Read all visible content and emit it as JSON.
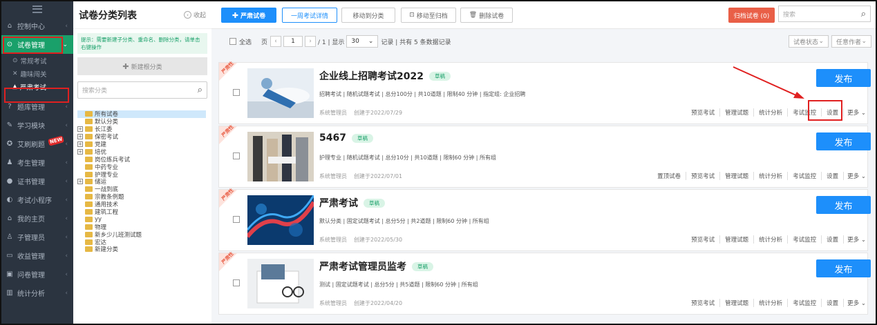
{
  "sidebar": {
    "items": [
      {
        "label": "控制中心",
        "icon": "home-icon",
        "glyph": "⌂"
      },
      {
        "label": "试卷管理",
        "icon": "check-circle-icon",
        "glyph": "⊙",
        "active": true
      },
      {
        "label": "题库管理",
        "icon": "question-icon",
        "glyph": "?"
      },
      {
        "label": "学习模块",
        "icon": "graduation-cap-icon",
        "glyph": "✎"
      },
      {
        "label": "艾刷刷题",
        "icon": "flame-icon",
        "glyph": "✪",
        "badge": "NEW"
      },
      {
        "label": "考生管理",
        "icon": "users-icon",
        "glyph": "♟"
      },
      {
        "label": "证书管理",
        "icon": "certificate-icon",
        "glyph": "●"
      },
      {
        "label": "考试小程序",
        "icon": "mini-program-icon",
        "glyph": "◐"
      },
      {
        "label": "我的主页",
        "icon": "house-icon",
        "glyph": "⌂"
      },
      {
        "label": "子管理员",
        "icon": "admin-icon",
        "glyph": "♙"
      },
      {
        "label": "收益管理",
        "icon": "income-icon",
        "glyph": "▭"
      },
      {
        "label": "问卷管理",
        "icon": "survey-icon",
        "glyph": "▣"
      },
      {
        "label": "统计分析",
        "icon": "stats-icon",
        "glyph": "▥"
      }
    ],
    "subitems": [
      {
        "label": "常规考试",
        "glyph": "⊙"
      },
      {
        "label": "趣味闯关",
        "glyph": "✕"
      },
      {
        "label": "严肃考试",
        "glyph": "▲"
      }
    ]
  },
  "category": {
    "title": "试卷分类列表",
    "collapse": "收起",
    "tip": "提示：需要新建子分类、重命名、删除分类，请单击右键操作",
    "new_root": "新建根分类",
    "search_placeholder": "搜索分类",
    "tree": [
      {
        "label": "所有试卷",
        "expandable": false,
        "selected": true
      },
      {
        "label": "默认分类",
        "expandable": false
      },
      {
        "label": "长江委",
        "expandable": true
      },
      {
        "label": "保密考试",
        "expandable": true
      },
      {
        "label": "党建",
        "expandable": true
      },
      {
        "label": "培优",
        "expandable": true
      },
      {
        "label": "岗位练兵考试",
        "expandable": false
      },
      {
        "label": "中药专业",
        "expandable": false
      },
      {
        "label": "护理专业",
        "expandable": false
      },
      {
        "label": "储运",
        "expandable": true
      },
      {
        "label": "一战到底",
        "expandable": false
      },
      {
        "label": "宗教条例题",
        "expandable": false
      },
      {
        "label": "通用技术",
        "expandable": false
      },
      {
        "label": "建筑工程",
        "expandable": false
      },
      {
        "label": "yy",
        "expandable": false
      },
      {
        "label": "物理",
        "expandable": false
      },
      {
        "label": "新乡少儿班测试题",
        "expandable": false
      },
      {
        "label": "宏达",
        "expandable": false
      },
      {
        "label": "新建分类",
        "expandable": false
      }
    ]
  },
  "toolbar": {
    "strict_exam": "严肃试卷",
    "week_details": "一周考试详情",
    "move_to_category": "移动到分类",
    "move_to_archive": "移动至归档",
    "delete_exam": "删除试卷",
    "archived": "归档试卷 (0)",
    "search_placeholder": "搜索"
  },
  "listbar": {
    "select_all": "全选",
    "page_label": "页",
    "page_current": "1",
    "page_total": "/ 1 | 显示",
    "page_size": "30",
    "record_text": "记录 | 共有 5 条数据记录",
    "status_filter": "试卷状态",
    "author_filter": "任意作者"
  },
  "exams": [
    {
      "title": "企业线上招聘考试2022",
      "status": "草稿",
      "ribbon": "严肃性",
      "meta": "招聘考试 | 随机试题考试 | 总分100分 | 共10道题 | 限制40 分钟 | 指定组: 企业招聘",
      "author": "系统管理员",
      "created": "创建于2022/07/29",
      "publish": "发布",
      "actions": [
        "预览考试",
        "管理试题",
        "统计分析",
        "考试监控",
        "设置"
      ],
      "more": "更多"
    },
    {
      "title": "5467",
      "status": "草稿",
      "ribbon": "严肃性",
      "meta": "护理专业 | 随机试题考试 | 总分10分 | 共10道题 | 限制60 分钟 | 所有组",
      "author": "系统管理员",
      "created": "创建于2022/07/01",
      "publish": "发布",
      "actions": [
        "置顶试卷",
        "预览考试",
        "管理试题",
        "统计分析",
        "考试监控",
        "设置"
      ],
      "more": "更多"
    },
    {
      "title": "严肃考试",
      "status": "草稿",
      "ribbon": "严肃性",
      "meta": "默认分类 | 固定试题考试 | 总分5分 | 共2道题 | 限制60 分钟 | 所有组",
      "author": "系统管理员",
      "created": "创建于2022/05/30",
      "publish": "发布",
      "actions": [
        "预览考试",
        "管理试题",
        "统计分析",
        "考试监控",
        "设置"
      ],
      "more": "更多"
    },
    {
      "title": "严肃考试管理员监考",
      "status": "草稿",
      "ribbon": "严肃性",
      "meta": "测试 | 固定试题考试 | 总分5分 | 共5道题 | 限制60 分钟 | 所有组",
      "author": "系统管理员",
      "created": "创建于2022/04/20",
      "publish": "发布",
      "actions": [
        "预览考试",
        "管理试题",
        "统计分析",
        "考试监控",
        "设置"
      ],
      "more": "更多"
    }
  ],
  "colors": {
    "accent": "#1d8ffb",
    "sidebar_bg": "#2b3440",
    "active_green": "#1aa06a",
    "highlight_red": "#e02020",
    "archive": "#e95f47"
  }
}
